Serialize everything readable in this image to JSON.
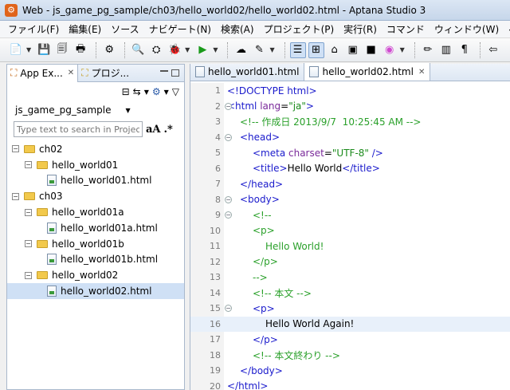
{
  "window": {
    "title": "Web - js_game_pg_sample/ch03/hello_world02/hello_world02.html - Aptana Studio 3",
    "app_icon": "aptana-logo-icon"
  },
  "menu": [
    "ファイル(F)",
    "編集(E)",
    "ソース",
    "ナビゲート(N)",
    "検索(A)",
    "プロジェクト(P)",
    "実行(R)",
    "コマンド",
    "ウィンドウ(W)",
    "ヘル"
  ],
  "left_panel": {
    "tabs": [
      {
        "label": "App Ex...",
        "close": "✕"
      },
      {
        "label": "プロジ..."
      }
    ],
    "project": "js_game_pg_sample",
    "search": {
      "placeholder": "Type text to search in Projec",
      "case_btn": "aA",
      "regex_btn": ".*"
    },
    "tree": [
      {
        "label": "ch02",
        "level": 0,
        "type": "folder",
        "toggle": "−"
      },
      {
        "label": "hello_world01",
        "level": 1,
        "type": "folder",
        "toggle": "−"
      },
      {
        "label": "hello_world01.html",
        "level": 2,
        "type": "file"
      },
      {
        "label": "ch03",
        "level": 0,
        "type": "folder",
        "toggle": "−"
      },
      {
        "label": "hello_world01a",
        "level": 1,
        "type": "folder",
        "toggle": "−"
      },
      {
        "label": "hello_world01a.html",
        "level": 2,
        "type": "file"
      },
      {
        "label": "hello_world01b",
        "level": 1,
        "type": "folder",
        "toggle": "−"
      },
      {
        "label": "hello_world01b.html",
        "level": 2,
        "type": "file"
      },
      {
        "label": "hello_world02",
        "level": 1,
        "type": "folder",
        "toggle": "−"
      },
      {
        "label": "hello_world02.html",
        "level": 2,
        "type": "file",
        "selected": true
      }
    ]
  },
  "editor": {
    "tabs": [
      {
        "label": "hello_world01.html",
        "active": false
      },
      {
        "label": "hello_world02.html",
        "active": true,
        "close": "✕"
      }
    ],
    "lines": [
      {
        "n": "1",
        "indent": 0,
        "parts": [
          [
            "tag",
            "<!DOCTYPE html>"
          ]
        ]
      },
      {
        "n": "2",
        "indent": 0,
        "fold": "⊖",
        "parts": [
          [
            "tag",
            "<html "
          ],
          [
            "attr",
            "lang"
          ],
          [
            "plain",
            "="
          ],
          [
            "val",
            "\"ja\""
          ],
          [
            "tag",
            ">"
          ]
        ]
      },
      {
        "n": "3",
        "indent": 1,
        "parts": [
          [
            "cmt",
            "<!-- 作成日 2013/9/7  10:25:45 AM -->"
          ]
        ]
      },
      {
        "n": "4",
        "indent": 1,
        "fold": "⊖",
        "parts": [
          [
            "tag",
            "<head>"
          ]
        ]
      },
      {
        "n": "5",
        "indent": 2,
        "parts": [
          [
            "tag",
            "<meta "
          ],
          [
            "attr",
            "charset"
          ],
          [
            "plain",
            "="
          ],
          [
            "val",
            "\"UTF-8\""
          ],
          [
            "tag",
            " />"
          ]
        ]
      },
      {
        "n": "6",
        "indent": 2,
        "parts": [
          [
            "tag",
            "<title>"
          ],
          [
            "plain",
            "Hello World"
          ],
          [
            "tag",
            "</title>"
          ]
        ]
      },
      {
        "n": "7",
        "indent": 1,
        "parts": [
          [
            "tag",
            "</head>"
          ]
        ]
      },
      {
        "n": "8",
        "indent": 1,
        "fold": "⊖",
        "parts": [
          [
            "tag",
            "<body>"
          ]
        ]
      },
      {
        "n": "9",
        "indent": 2,
        "fold": "⊖",
        "parts": [
          [
            "cmt",
            "<!--"
          ]
        ]
      },
      {
        "n": "10",
        "indent": 2,
        "parts": [
          [
            "cmt",
            "<p>"
          ]
        ]
      },
      {
        "n": "11",
        "indent": 3,
        "parts": [
          [
            "cmt",
            "Hello World!"
          ]
        ]
      },
      {
        "n": "12",
        "indent": 2,
        "parts": [
          [
            "cmt",
            "</p>"
          ]
        ]
      },
      {
        "n": "13",
        "indent": 2,
        "parts": [
          [
            "cmt",
            "-->"
          ]
        ]
      },
      {
        "n": "14",
        "indent": 2,
        "parts": [
          [
            "cmt",
            "<!-- 本文 -->"
          ]
        ]
      },
      {
        "n": "15",
        "indent": 2,
        "fold": "⊖",
        "parts": [
          [
            "tag",
            "<p>"
          ]
        ]
      },
      {
        "n": "16",
        "indent": 3,
        "current": true,
        "parts": [
          [
            "plain",
            "Hello World Again!"
          ]
        ]
      },
      {
        "n": "17",
        "indent": 2,
        "parts": [
          [
            "tag",
            "</p>"
          ]
        ]
      },
      {
        "n": "18",
        "indent": 2,
        "parts": [
          [
            "cmt",
            "<!-- 本文終わり -->"
          ]
        ]
      },
      {
        "n": "19",
        "indent": 1,
        "parts": [
          [
            "tag",
            "</body>"
          ]
        ]
      },
      {
        "n": "20",
        "indent": 0,
        "parts": [
          [
            "tag",
            "</html>"
          ]
        ]
      }
    ]
  }
}
